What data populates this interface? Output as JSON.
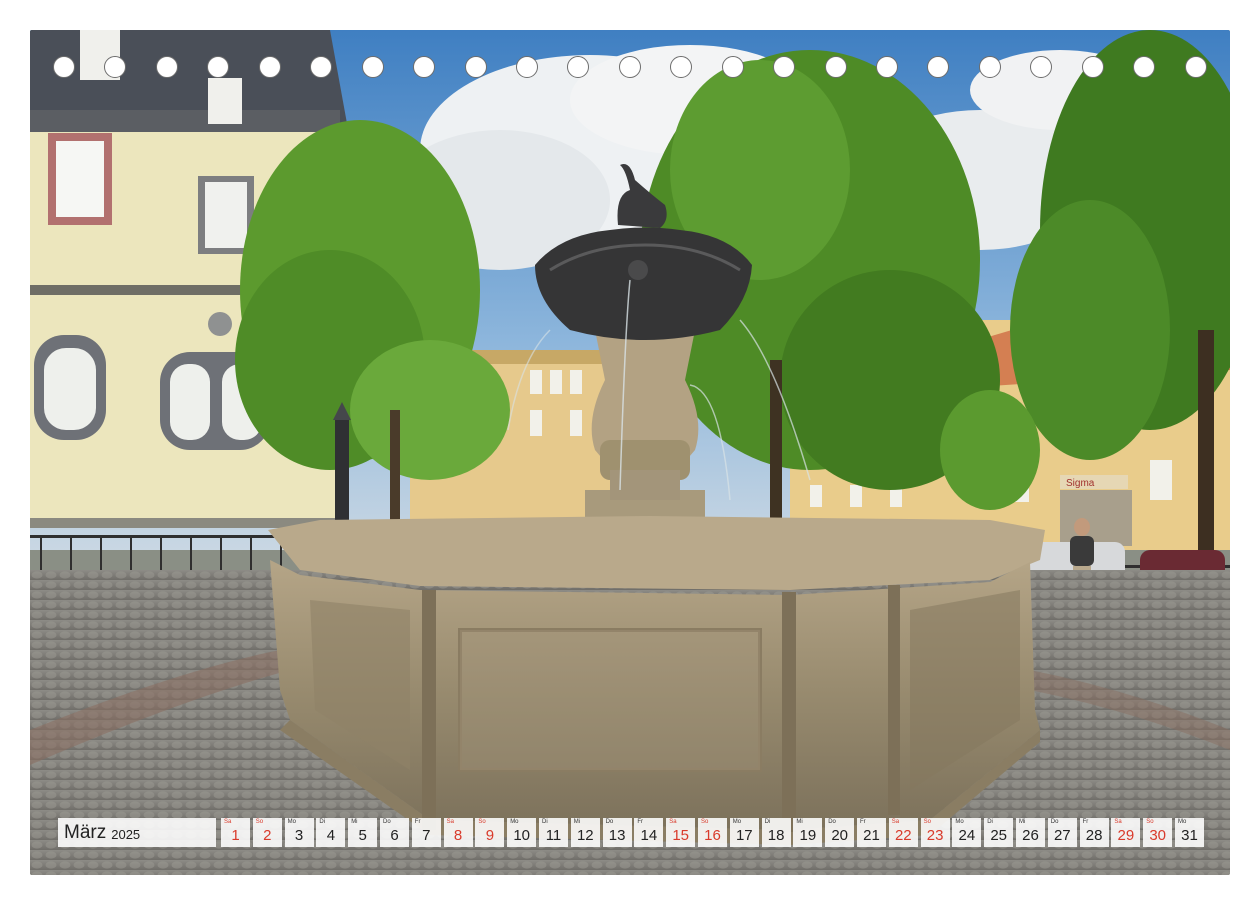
{
  "calendar": {
    "month": "März",
    "year": "2025",
    "weekend_color": "#d93a2b",
    "days": [
      {
        "dow": "Sa",
        "num": "1",
        "weekend": true
      },
      {
        "dow": "So",
        "num": "2",
        "weekend": true
      },
      {
        "dow": "Mo",
        "num": "3",
        "weekend": false
      },
      {
        "dow": "Di",
        "num": "4",
        "weekend": false
      },
      {
        "dow": "Mi",
        "num": "5",
        "weekend": false
      },
      {
        "dow": "Do",
        "num": "6",
        "weekend": false
      },
      {
        "dow": "Fr",
        "num": "7",
        "weekend": false
      },
      {
        "dow": "Sa",
        "num": "8",
        "weekend": true
      },
      {
        "dow": "So",
        "num": "9",
        "weekend": true
      },
      {
        "dow": "Mo",
        "num": "10",
        "weekend": false
      },
      {
        "dow": "Di",
        "num": "11",
        "weekend": false
      },
      {
        "dow": "Mi",
        "num": "12",
        "weekend": false
      },
      {
        "dow": "Do",
        "num": "13",
        "weekend": false
      },
      {
        "dow": "Fr",
        "num": "14",
        "weekend": false
      },
      {
        "dow": "Sa",
        "num": "15",
        "weekend": true
      },
      {
        "dow": "So",
        "num": "16",
        "weekend": true
      },
      {
        "dow": "Mo",
        "num": "17",
        "weekend": false
      },
      {
        "dow": "Di",
        "num": "18",
        "weekend": false
      },
      {
        "dow": "Mi",
        "num": "19",
        "weekend": false
      },
      {
        "dow": "Do",
        "num": "20",
        "weekend": false
      },
      {
        "dow": "Fr",
        "num": "21",
        "weekend": false
      },
      {
        "dow": "Sa",
        "num": "22",
        "weekend": true
      },
      {
        "dow": "So",
        "num": "23",
        "weekend": true
      },
      {
        "dow": "Mo",
        "num": "24",
        "weekend": false
      },
      {
        "dow": "Di",
        "num": "25",
        "weekend": false
      },
      {
        "dow": "Mi",
        "num": "26",
        "weekend": false
      },
      {
        "dow": "Do",
        "num": "27",
        "weekend": false
      },
      {
        "dow": "Fr",
        "num": "28",
        "weekend": false
      },
      {
        "dow": "Sa",
        "num": "29",
        "weekend": true
      },
      {
        "dow": "So",
        "num": "30",
        "weekend": true
      },
      {
        "dow": "Mo",
        "num": "31",
        "weekend": false
      }
    ]
  },
  "photo": {
    "subject": "fountain-on-town-square",
    "shop_sign": "Sigma"
  }
}
